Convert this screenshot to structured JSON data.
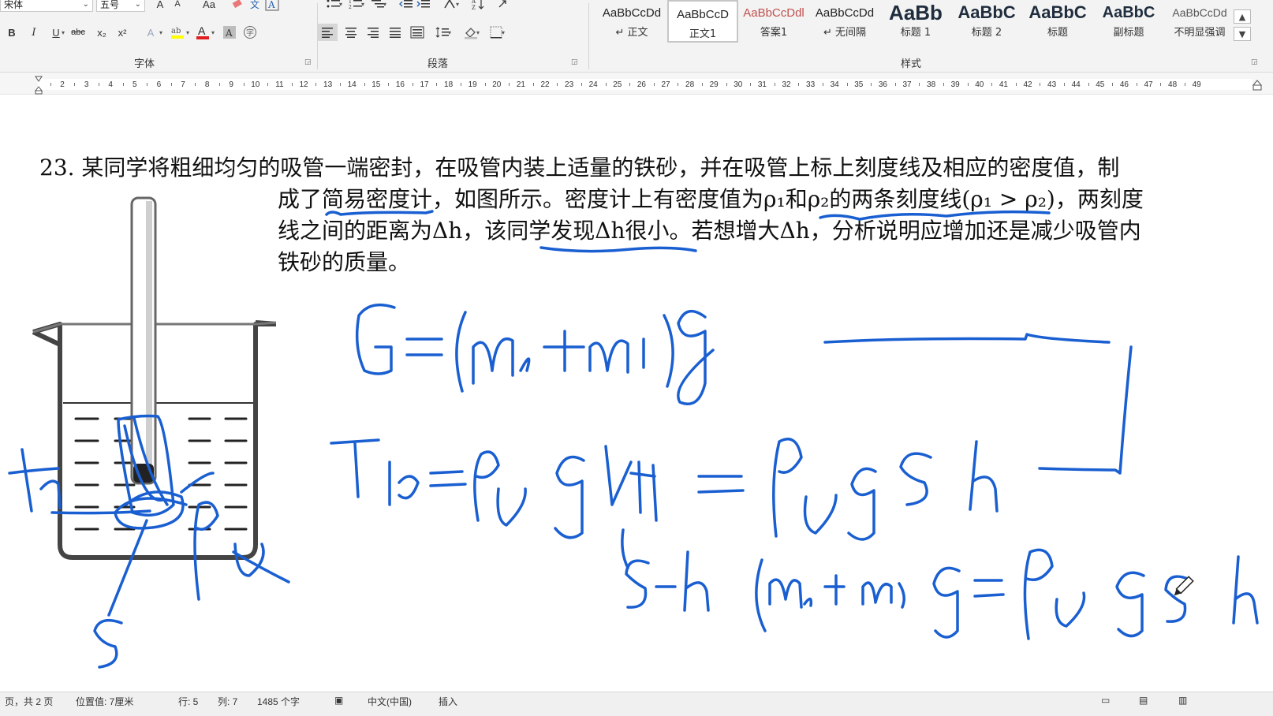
{
  "ribbon": {
    "font_group": {
      "font_name": "宋体",
      "font_size": "五号",
      "grow_label": "A",
      "shrink_label": "A",
      "case_label": "Aa",
      "bold": "B",
      "italic": "I",
      "underline": "U",
      "strikethrough": "abc",
      "subscript": "x₂",
      "superscript": "x²",
      "font_color_label": "A",
      "char_shading_label": "A",
      "label": "字体"
    },
    "paragraph_group": {
      "label": "段落"
    },
    "styles_group": {
      "label": "样式",
      "items": [
        {
          "sample": "AaBbCcDd",
          "name": "↵ 正文",
          "color": "#222222",
          "sample_size": 15
        },
        {
          "sample": "AaBbCcD",
          "name": "正文1",
          "color": "#222222",
          "sample_size": 15
        },
        {
          "sample": "AaBbCcDdl",
          "name": "答案1",
          "color": "#c0504d",
          "sample_size": 15
        },
        {
          "sample": "AaBbCcDd",
          "name": "↵ 无间隔",
          "color": "#222222",
          "sample_size": 15
        },
        {
          "sample": "AaBb",
          "name": "标题 1",
          "color": "#1f2d3d",
          "sample_size": 26
        },
        {
          "sample": "AaBbC",
          "name": "标题 2",
          "color": "#1f2d3d",
          "sample_size": 22
        },
        {
          "sample": "AaBbC",
          "name": "标题",
          "color": "#1f2d3d",
          "sample_size": 22
        },
        {
          "sample": "AaBbC",
          "name": "副标题",
          "color": "#1f2d3d",
          "sample_size": 20
        },
        {
          "sample": "AaBbCcDd",
          "name": "不明显强调",
          "color": "#555555",
          "sample_size": 14
        }
      ]
    }
  },
  "ruler": {
    "numbers": [
      "2",
      "3",
      "4",
      "5",
      "6",
      "7",
      "8",
      "9",
      "10",
      "11",
      "12",
      "13",
      "14",
      "15",
      "16",
      "17",
      "18",
      "19",
      "20",
      "21",
      "22",
      "23",
      "24",
      "25",
      "26",
      "27",
      "28",
      "29",
      "30",
      "31",
      "32",
      "33",
      "34",
      "35",
      "36",
      "37",
      "38",
      "39",
      "40",
      "41",
      "42",
      "43",
      "44",
      "45",
      "46",
      "47",
      "48",
      "49"
    ]
  },
  "document": {
    "question_lines": [
      "23. 某同学将粗细均匀的吸管一端密封，在吸管内装上适量的铁砂，并在吸管上标上刻度线及相应的密度值，制",
      "成了简易密度计，如图所示。密度计上有密度值为ρ₁和ρ₂的两条刻度线(ρ₁ > ρ₂)，两刻度",
      "线之间的距离为Δh，该同学发现Δh很小。若想增大Δh，分析说明应增加还是减少吸管内",
      "铁砂的质量。"
    ]
  },
  "status_bar": {
    "page": "页，共 2 页",
    "position": "位置值: 7厘米",
    "line": "行: 5",
    "column": "列: 7",
    "word_count": "1485 个字",
    "language": "中文(中国)",
    "mode": "插入"
  },
  "colors": {
    "ink": "#1a5fd1",
    "ribbon_bg": "#f3f3f3",
    "answer_red": "#c0504d"
  }
}
